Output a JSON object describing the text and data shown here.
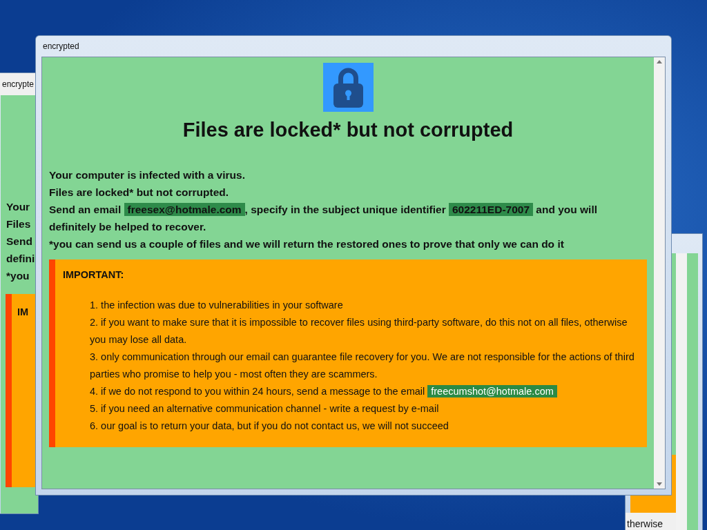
{
  "back_window": {
    "title": "encrypte",
    "lines": [
      "Your",
      "Files",
      "Send",
      "defini",
      "*you"
    ],
    "notice_heading": "IM"
  },
  "side_window": {
    "text": "therwise"
  },
  "main_window": {
    "title": "encrypted",
    "heading": "Files are locked* but not corrupted",
    "paragraphs": [
      [
        {
          "text": "Your computer is infected with a virus.",
          "highlight": false
        }
      ],
      [
        {
          "text": "Files are locked* but not corrupted.",
          "highlight": false
        }
      ],
      [
        {
          "text": "Send an email ",
          "highlight": false
        },
        {
          "text": "freesex@hotmale.com",
          "highlight": true
        },
        {
          "text": ", specify in the subject unique identifier ",
          "highlight": false
        },
        {
          "text": "602211ED-7007",
          "highlight": true
        },
        {
          "text": " and you will definitely be helped to recover.",
          "highlight": false
        }
      ],
      [
        {
          "text": "*you can send us a couple of files and we will return the restored ones to prove that only we can do it",
          "highlight": false
        }
      ]
    ],
    "notice": {
      "heading": "IMPORTANT:",
      "items": [
        [
          {
            "text": "1. the infection was due to vulnerabilities in your software",
            "highlight": false
          }
        ],
        [
          {
            "text": "2. if you want to make sure that it is impossible to recover files using third-party software, do this not on all files, otherwise you may lose all data.",
            "highlight": false
          }
        ],
        [
          {
            "text": "3. only communication through our email can guarantee file recovery for you. We are not responsible for the actions of third parties who promise to help you - most often they are scammers.",
            "highlight": false
          }
        ],
        [
          {
            "text": "4. if we do not respond to you within 24 hours, send a message to the email ",
            "highlight": false
          },
          {
            "text": "freecumshot@hotmale.com",
            "highlight": true
          }
        ],
        [
          {
            "text": "5. if you need an alternative communication channel - write a request by e-mail",
            "highlight": false
          }
        ],
        [
          {
            "text": "6. our goal is to return your data, but if you do not contact us, we will not succeed",
            "highlight": false
          }
        ]
      ]
    }
  }
}
